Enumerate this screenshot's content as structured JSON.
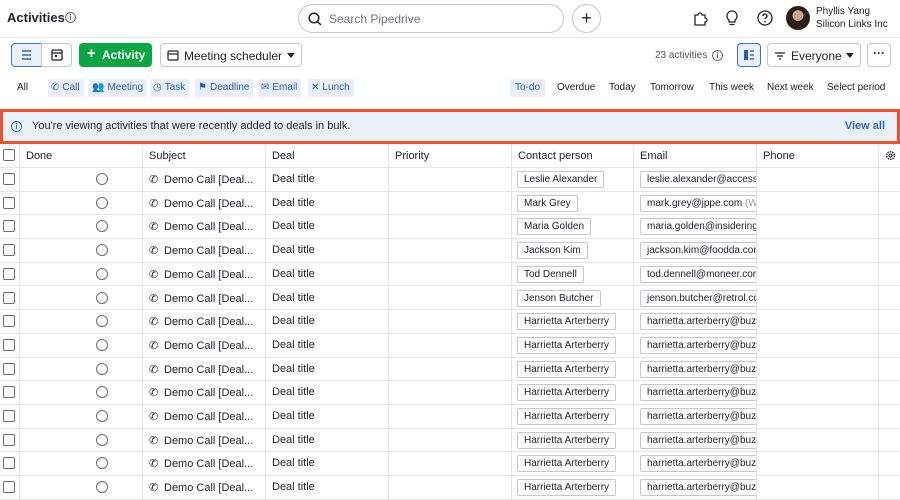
{
  "header": {
    "title": "Activities",
    "search_placeholder": "Search Pipedrive",
    "user_name": "Phyllis Yang",
    "user_company": "Silicon Links Inc"
  },
  "toolbar": {
    "add_activity_label": "Activity",
    "scheduler_label": "Meeting scheduler",
    "activity_count": "23 activities",
    "owner_filter_label": "Everyone",
    "more_label": "···"
  },
  "filters": {
    "all_label": "All",
    "types": [
      {
        "label": "Call",
        "icon": "phone-icon"
      },
      {
        "label": "Meeting",
        "icon": "people-icon"
      },
      {
        "label": "Task",
        "icon": "clock-icon"
      },
      {
        "label": "Deadline",
        "icon": "flag-icon"
      },
      {
        "label": "Email",
        "icon": "envelope-icon"
      },
      {
        "label": "Lunch",
        "icon": "utensils-icon"
      }
    ],
    "ranges": [
      "To-do",
      "Overdue",
      "Today",
      "Tomorrow",
      "This week",
      "Next week",
      "Select period"
    ],
    "active_range": "To-do"
  },
  "banner": {
    "text": "You're viewing activities that were recently added to deals in bulk.",
    "link": "View all",
    "border_color": "#f0512a"
  },
  "table": {
    "columns": [
      "Done",
      "Subject",
      "Deal",
      "Priority",
      "Contact person",
      "Email",
      "Phone"
    ],
    "rows": [
      {
        "subject": "Demo Call [Deal...",
        "deal": "Deal title",
        "contact": "Leslie Alexander",
        "email": "leslie.alexander@accesse",
        "email_sub": ""
      },
      {
        "subject": "Demo Call [Deal...",
        "deal": "Deal title",
        "contact": "Mark Grey",
        "email": "mark.grey@jppe.com",
        "email_sub": "(W"
      },
      {
        "subject": "Demo Call [Deal...",
        "deal": "Deal title",
        "contact": "Maria Golden",
        "email": "maria.golden@insidering",
        "email_sub": ""
      },
      {
        "subject": "Demo Call [Deal...",
        "deal": "Deal title",
        "contact": "Jackson Kim",
        "email": "jackson.kim@foodda.con",
        "email_sub": ""
      },
      {
        "subject": "Demo Call [Deal...",
        "deal": "Deal title",
        "contact": "Tod Dennell",
        "email": "tod.dennell@moneer.com",
        "email_sub": ""
      },
      {
        "subject": "Demo Call [Deal...",
        "deal": "Deal title",
        "contact": "Jenson Butcher",
        "email": "jenson.butcher@retrol.cc",
        "email_sub": ""
      },
      {
        "subject": "Demo Call [Deal...",
        "deal": "Deal title",
        "contact": "Harrietta Arterberry",
        "email": "harrietta.arterberry@buz",
        "email_sub": ""
      },
      {
        "subject": "Demo Call [Deal...",
        "deal": "Deal title",
        "contact": "Harrietta Arterberry",
        "email": "harrietta.arterberry@buz",
        "email_sub": ""
      },
      {
        "subject": "Demo Call [Deal...",
        "deal": "Deal title",
        "contact": "Harrietta Arterberry",
        "email": "harrietta.arterberry@buz",
        "email_sub": ""
      },
      {
        "subject": "Demo Call [Deal...",
        "deal": "Deal title",
        "contact": "Harrietta Arterberry",
        "email": "harrietta.arterberry@buz",
        "email_sub": ""
      },
      {
        "subject": "Demo Call [Deal...",
        "deal": "Deal title",
        "contact": "Harrietta Arterberry",
        "email": "harrietta.arterberry@buz",
        "email_sub": ""
      },
      {
        "subject": "Demo Call [Deal...",
        "deal": "Deal title",
        "contact": "Harrietta Arterberry",
        "email": "harrietta.arterberry@buz",
        "email_sub": ""
      },
      {
        "subject": "Demo Call [Deal...",
        "deal": "Deal title",
        "contact": "Harrietta Arterberry",
        "email": "harrietta.arterberry@buz",
        "email_sub": ""
      },
      {
        "subject": "Demo Call [Deal...",
        "deal": "Deal title",
        "contact": "Harrietta Arterberry",
        "email": "harrietta.arterberry@buz",
        "email_sub": ""
      }
    ]
  }
}
